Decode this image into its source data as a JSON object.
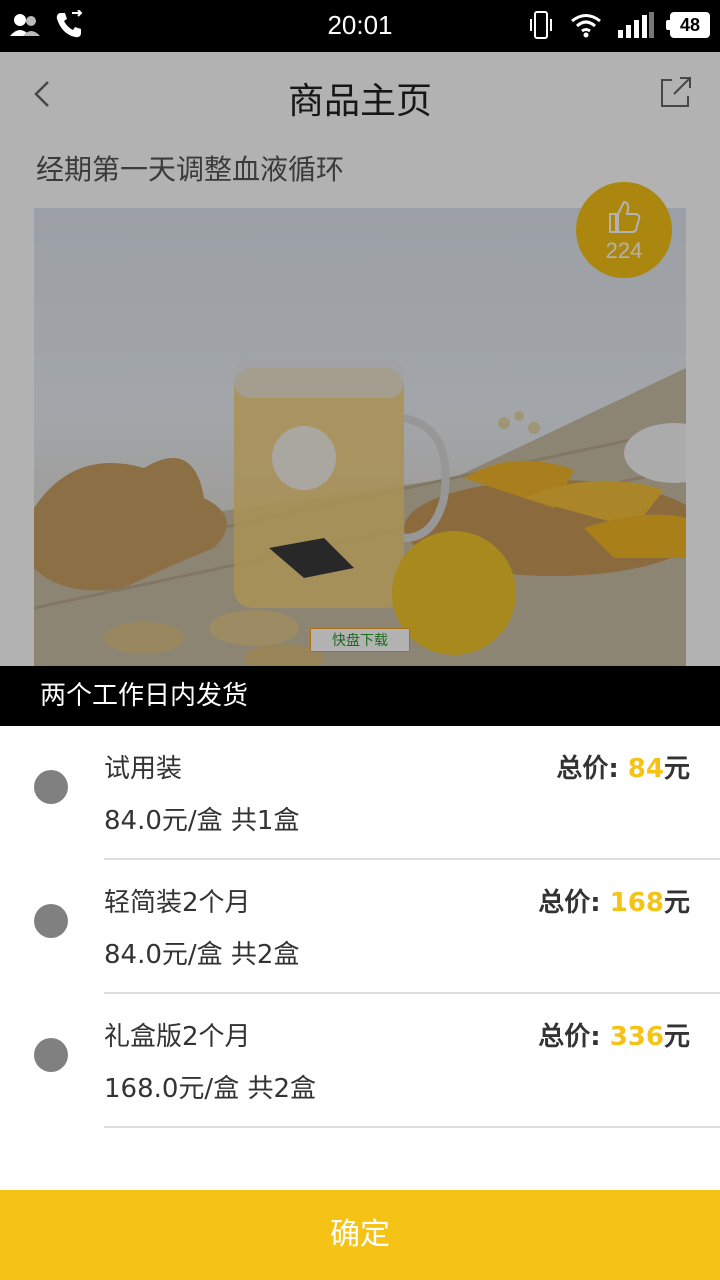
{
  "status_bar": {
    "time": "20:01",
    "battery": "48",
    "icons": [
      "contacts-icon",
      "call-forward-icon",
      "vibrate-icon",
      "wifi-icon",
      "signal-icon",
      "battery-icon"
    ]
  },
  "nav": {
    "title": "商品主页",
    "back_icon": "chevron-left-icon",
    "share_icon": "share-icon"
  },
  "product": {
    "subtitle": "经期第一天调整血液循环",
    "like_count": "224",
    "watermark": "快盘下载"
  },
  "sheet": {
    "header": "两个工作日内发货",
    "total_label": "总价: ",
    "currency": "元",
    "options": [
      {
        "name": "试用装",
        "unit": "84.0元/盒 共1盒",
        "total": "84"
      },
      {
        "name": "轻简装2个月",
        "unit": "84.0元/盒 共2盒",
        "total": "168"
      },
      {
        "name": "礼盒版2个月",
        "unit": "168.0元/盒 共2盒",
        "total": "336"
      }
    ]
  },
  "confirm_label": "确定",
  "colors": {
    "accent": "#f5c216",
    "radio": "#808080"
  }
}
